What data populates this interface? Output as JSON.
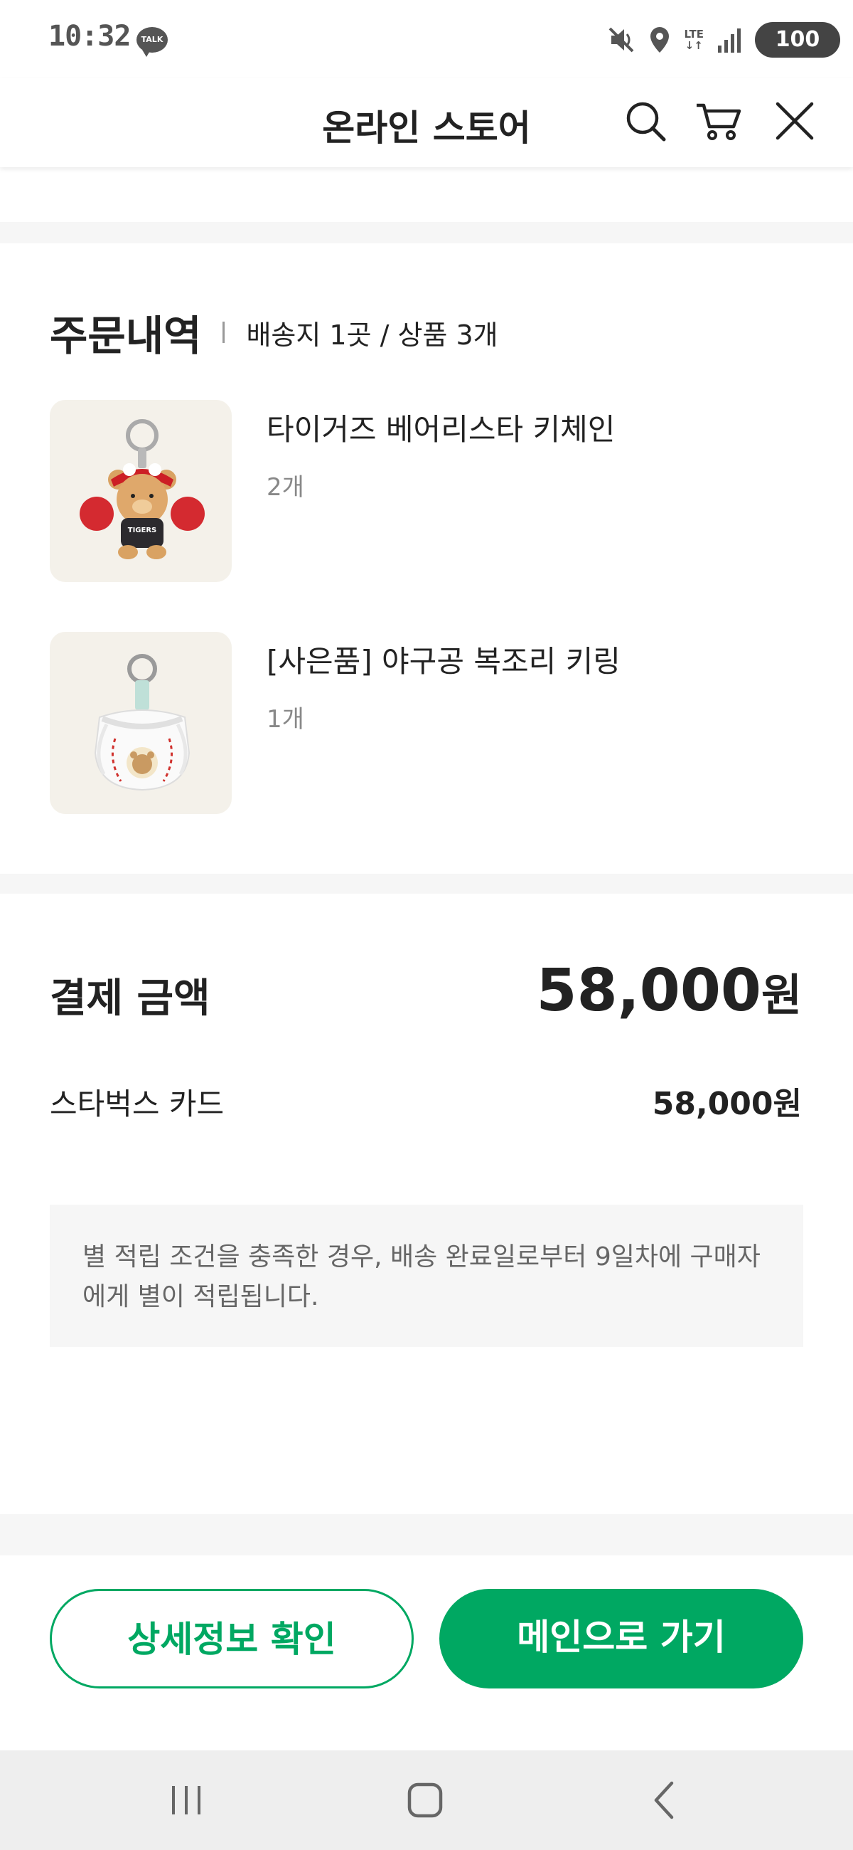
{
  "status_bar": {
    "time": "10:32",
    "talk_badge": "TALK",
    "network": "LTE",
    "battery": "100",
    "icons": [
      "mute-icon",
      "location-icon",
      "lte-icon",
      "signal-icon",
      "battery-icon"
    ]
  },
  "header": {
    "title": "온라인 스토어",
    "icons": [
      "search-icon",
      "cart-icon",
      "close-icon"
    ]
  },
  "order": {
    "title": "주문내역",
    "summary": "배송지 1곳 / 상품 3개",
    "items": [
      {
        "name": "타이거즈 베어리스타 키체인",
        "qty": "2개",
        "image": "bear-keychain-image"
      },
      {
        "name": "[사은품] 야구공 복조리 키링",
        "qty": "1개",
        "image": "baseball-pouch-keyring-image"
      }
    ]
  },
  "payment": {
    "label": "결제 금액",
    "total_number": "58,000",
    "total_unit": "원",
    "method_label": "스타벅스 카드",
    "method_amount": "58,000원"
  },
  "notice": {
    "text": "별 적립 조건을 충족한 경우, 배송 완료일로부터 9일차에 구매자에게 별이 적립됩니다."
  },
  "actions": {
    "detail_button": "상세정보 확인",
    "main_button": "메인으로 가기"
  },
  "nav": {
    "icons": [
      "recent-apps-icon",
      "home-icon",
      "back-icon"
    ]
  },
  "colors": {
    "accent": "#00a862",
    "band": "#f6f6f6",
    "thumb_bg": "#f4f1ea"
  }
}
